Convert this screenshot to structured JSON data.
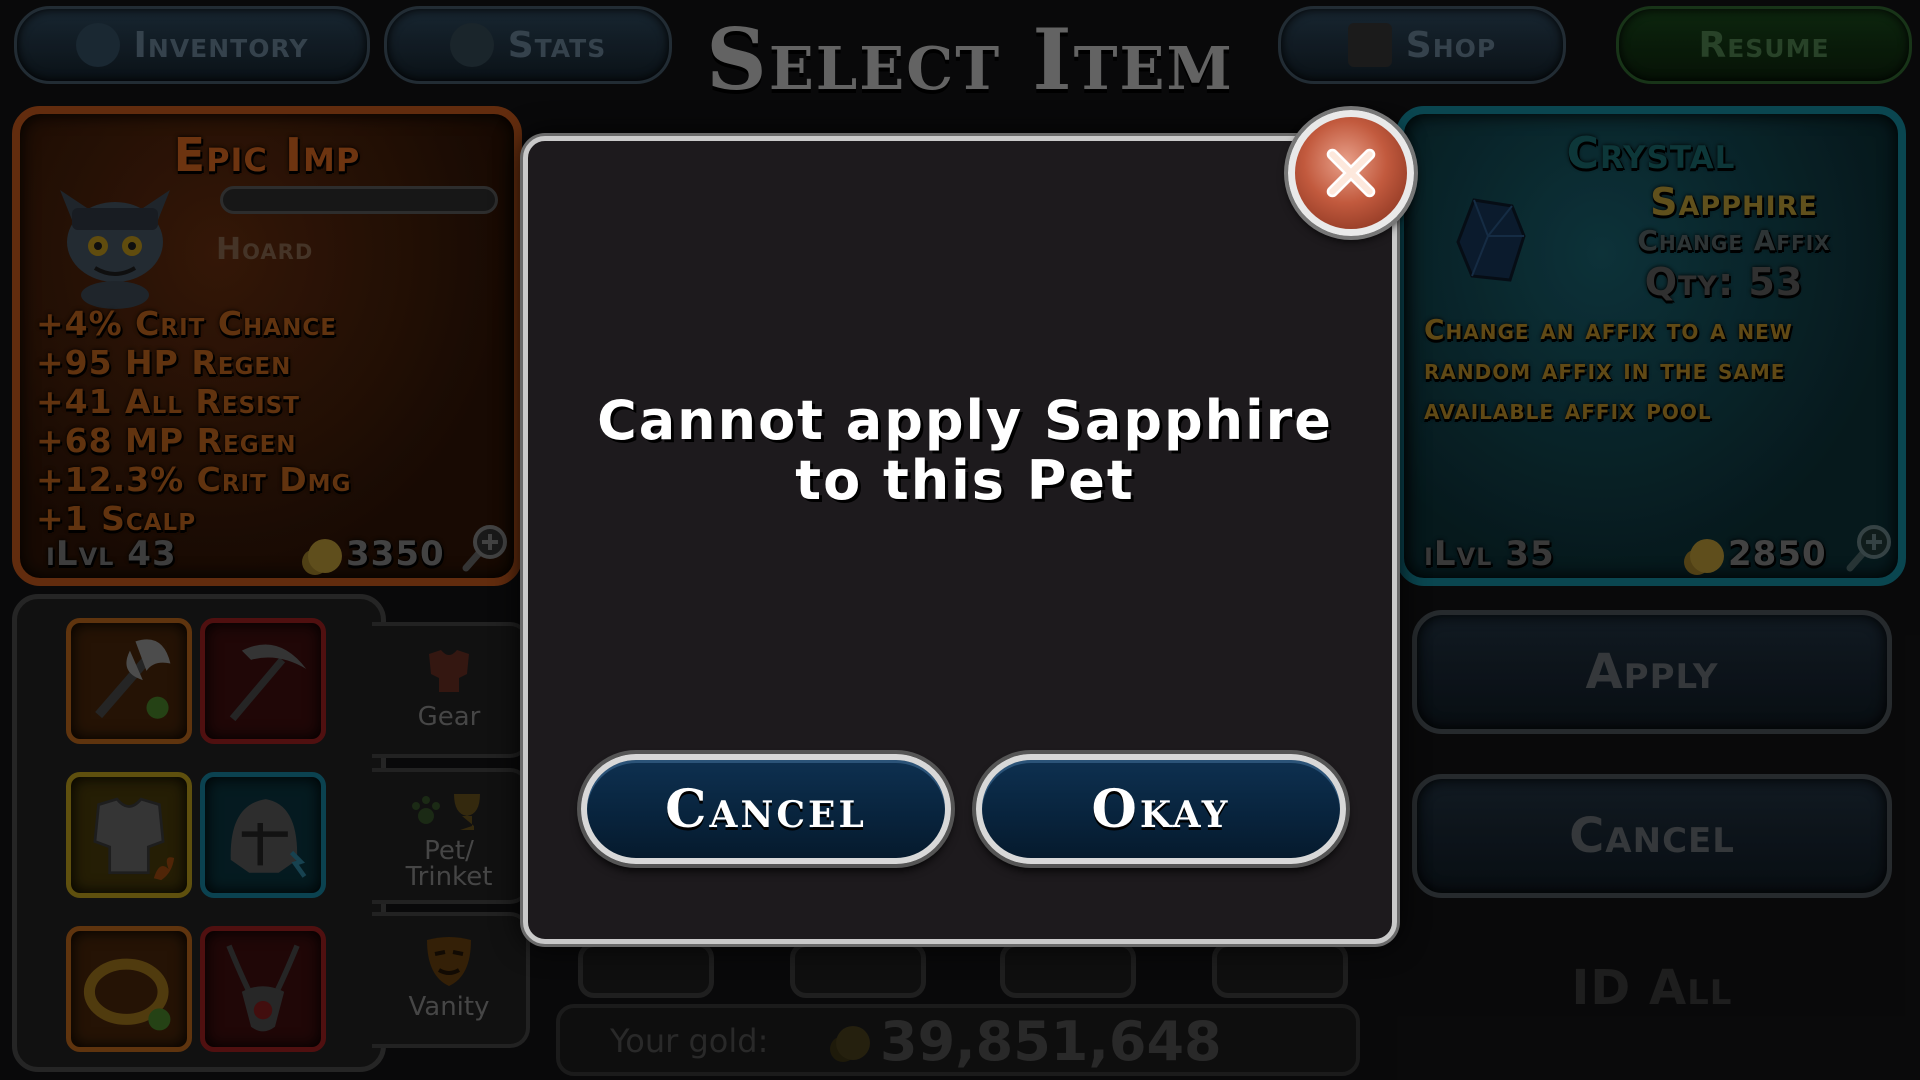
{
  "nav": {
    "inventory": "Inventory",
    "stats": "Stats",
    "shop": "Shop",
    "resume": "Resume"
  },
  "title": "Select Item",
  "pet": {
    "name": "Epic Imp",
    "affix": "Hoard",
    "stats": [
      "+4% Crit Chance",
      "+95 HP Regen",
      "+41 All Resist",
      "+68 MP Regen",
      "+12.3% Crit Dmg",
      "+1 Scalp"
    ],
    "ilvl": "iLvl 43",
    "gold": "3350"
  },
  "item": {
    "name_line1": "Crystal",
    "name_line2": "Sapphire",
    "subtitle": "Change Affix",
    "qty": "Qty: 53",
    "description": "Change an affix to a new random affix in the same available affix pool",
    "ilvl": "iLvl 35",
    "gold": "2850"
  },
  "actions": {
    "apply": "Apply",
    "cancel": "Cancel",
    "id_all": "ID All"
  },
  "tabs": {
    "gear": "Gear",
    "pet_trinket": "Pet/ Trinket",
    "vanity": "Vanity"
  },
  "footer": {
    "your_gold_label": "Your gold:",
    "your_gold_value": "39,851,648"
  },
  "modal": {
    "message_line1": "Cannot apply Sapphire",
    "message_line2": "to this Pet",
    "cancel": "Cancel",
    "okay": "Okay"
  },
  "colors": {
    "modal_border": "#c9c9c9",
    "button_fill": "#0a2844",
    "close_button": "#c25a3e",
    "pet_card_border": "#6e3210",
    "item_card_border": "#0c4e5a"
  },
  "icons": [
    "close-x-icon",
    "imp-pet-icon",
    "sapphire-gem-icon",
    "gold-coin-icon",
    "magnify-plus-icon",
    "axe-icon",
    "pickaxe-icon",
    "armor-icon",
    "helmet-icon",
    "ring-icon",
    "amulet-icon",
    "gear-tab-icon",
    "pet-trinket-tab-icon",
    "vanity-mask-icon"
  ]
}
